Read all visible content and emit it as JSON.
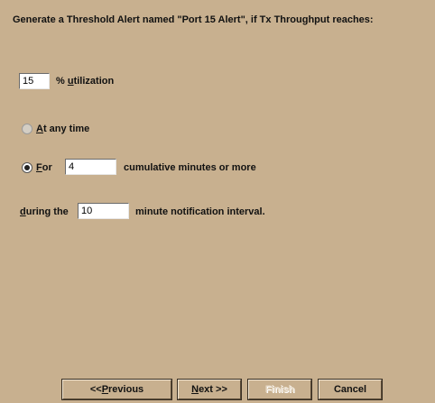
{
  "header": {
    "text": "Generate a Threshold Alert named \"Port 15 Alert\",  if Tx Throughput reaches:"
  },
  "utilization": {
    "value": "15",
    "label_prefix": "% ",
    "label_underlined": "u",
    "label_rest": "tilization"
  },
  "anytime": {
    "label_underlined": "A",
    "label_rest": "t any time",
    "checked": false
  },
  "for_option": {
    "label_underlined": "F",
    "label_rest": "or",
    "checked": true,
    "value": "4",
    "suffix": "cumulative minutes or more"
  },
  "interval": {
    "label_underlined": "d",
    "label_rest": "uring the",
    "value": "10",
    "suffix": "minute notification interval."
  },
  "buttons": {
    "previous": {
      "prefix": "<< ",
      "underlined": "P",
      "rest": "revious"
    },
    "next": {
      "underlined": "N",
      "rest": "ext >>"
    },
    "finish": "Finish",
    "cancel": "Cancel"
  },
  "colors": {
    "background": "#c8b08f",
    "field": "#ffffff",
    "disabled_text": "#e6d9c5"
  }
}
